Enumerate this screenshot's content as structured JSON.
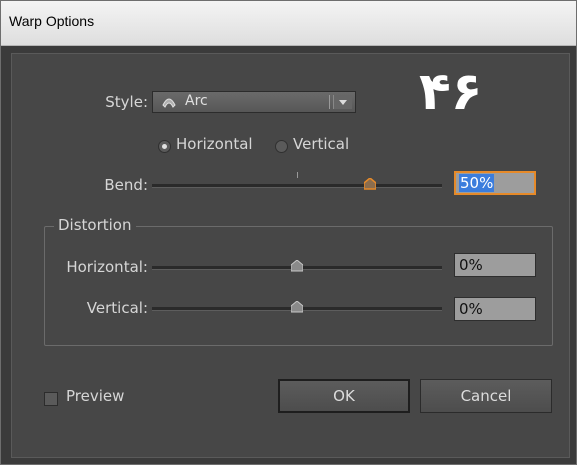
{
  "window": {
    "title": "Warp Options"
  },
  "watermark": {
    "text": "۴۶"
  },
  "style": {
    "label": "Style:",
    "value": "Arc"
  },
  "orientation": {
    "horizontal_label": "Horizontal",
    "vertical_label": "Vertical",
    "selected": "horizontal"
  },
  "bend": {
    "label": "Bend:",
    "value": "50%",
    "level_percent": 50
  },
  "distortion": {
    "title": "Distortion",
    "horizontal": {
      "label": "Horizontal:",
      "value": "0%",
      "level_percent": 0
    },
    "vertical": {
      "label": "Vertical:",
      "value": "0%",
      "level_percent": 0
    }
  },
  "preview": {
    "label": "Preview",
    "checked": false
  },
  "buttons": {
    "ok": "OK",
    "cancel": "Cancel"
  },
  "colors": {
    "accent": "#e68a29",
    "selection": "#3b7ddd"
  }
}
